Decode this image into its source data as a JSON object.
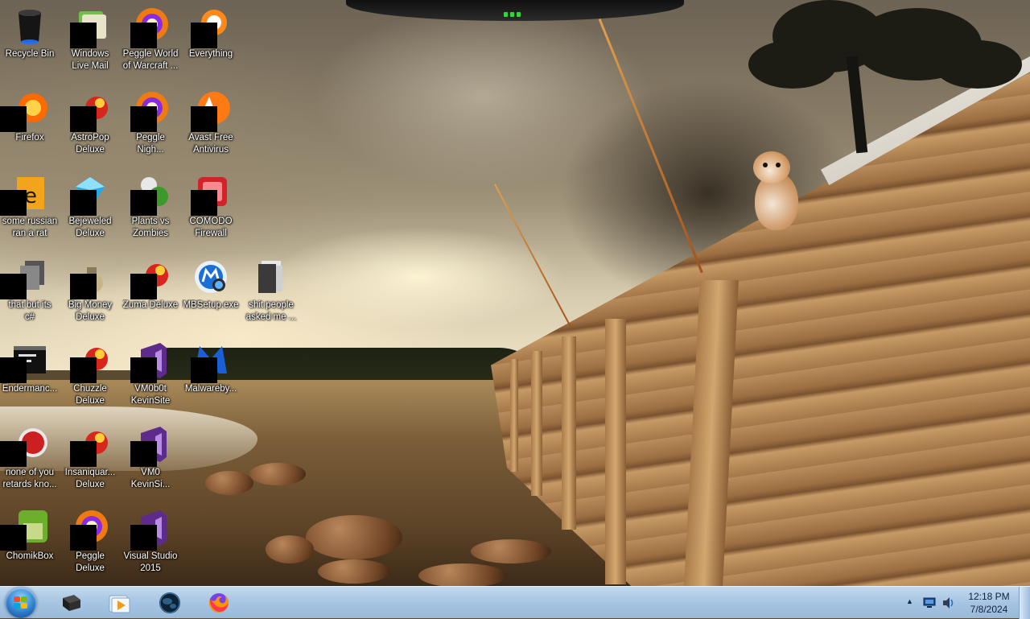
{
  "desktop": {
    "icons": [
      {
        "label": "Recycle Bin",
        "icon": "recycle-bin-icon",
        "col": 0,
        "row": 0,
        "censored": false
      },
      {
        "label": "Windows\nLive Mail",
        "icon": "mail-icon",
        "col": 1,
        "row": 0,
        "censored": true
      },
      {
        "label": "Peggle World\nof Warcraft ...",
        "icon": "peggle-icon",
        "col": 2,
        "row": 0,
        "censored": true
      },
      {
        "label": "Everything",
        "icon": "search-icon",
        "col": 3,
        "row": 0,
        "censored": true
      },
      {
        "label": "Firefox",
        "icon": "firefox-icon",
        "col": 0,
        "row": 1,
        "censored": true
      },
      {
        "label": "AstroPop\nDeluxe",
        "icon": "game-icon",
        "col": 1,
        "row": 1,
        "censored": true
      },
      {
        "label": "Peggle\nNigh...",
        "icon": "peggle-icon",
        "col": 2,
        "row": 1,
        "censored": true
      },
      {
        "label": "Avast Free\nAntivirus",
        "icon": "antivirus-icon",
        "col": 3,
        "row": 1,
        "censored": true
      },
      {
        "label": "some russian\nran a rat",
        "icon": "archive-icon",
        "col": 0,
        "row": 2,
        "censored": true
      },
      {
        "label": "Bejeweled\nDeluxe",
        "icon": "gem-icon",
        "col": 1,
        "row": 2,
        "censored": true
      },
      {
        "label": "Plants vs\nZombies",
        "icon": "plant-icon",
        "col": 2,
        "row": 2,
        "censored": true
      },
      {
        "label": "COMODO\nFirewall",
        "icon": "firewall-icon",
        "col": 3,
        "row": 2,
        "censored": true
      },
      {
        "label": "that but its\nc#",
        "icon": "file-icon",
        "col": 0,
        "row": 3,
        "censored": true
      },
      {
        "label": "Big Money\nDeluxe",
        "icon": "money-bag-icon",
        "col": 1,
        "row": 3,
        "censored": true
      },
      {
        "label": "Zuma Deluxe",
        "icon": "game-icon",
        "col": 2,
        "row": 3,
        "censored": true
      },
      {
        "label": "MBSetup.exe",
        "icon": "malwarebytes-setup-icon",
        "col": 3,
        "row": 3,
        "censored": false
      },
      {
        "label": "shit people\nasked me ...",
        "icon": "folder-icon",
        "col": 4,
        "row": 3,
        "censored": false
      },
      {
        "label": "Endermanc...",
        "icon": "terminal-icon",
        "col": 0,
        "row": 4,
        "censored": true
      },
      {
        "label": "Chuzzle\nDeluxe",
        "icon": "game-icon",
        "col": 1,
        "row": 4,
        "censored": true
      },
      {
        "label": "VM0b0t\nKevinSite",
        "icon": "visual-studio-icon",
        "col": 2,
        "row": 4,
        "censored": true
      },
      {
        "label": "Malwareby...",
        "icon": "malwarebytes-icon",
        "col": 3,
        "row": 4,
        "censored": true
      },
      {
        "label": "none of you\nretards kno...",
        "icon": "app-icon",
        "col": 0,
        "row": 5,
        "censored": true
      },
      {
        "label": "Insaniquar...\nDeluxe",
        "icon": "game-icon",
        "col": 1,
        "row": 5,
        "censored": true
      },
      {
        "label": "VM0\nKevinSi...",
        "icon": "visual-studio-icon",
        "col": 2,
        "row": 5,
        "censored": true
      },
      {
        "label": "ChomikBox",
        "icon": "chomikbox-icon",
        "col": 0,
        "row": 6,
        "censored": true
      },
      {
        "label": "Peggle\nDeluxe",
        "icon": "peggle-icon",
        "col": 1,
        "row": 6,
        "censored": true
      },
      {
        "label": "Visual Studio\n2015",
        "icon": "visual-studio-icon",
        "col": 2,
        "row": 6,
        "censored": true
      }
    ]
  },
  "taskbar": {
    "start_button": "windows-start-icon",
    "pinned": [
      {
        "icon": "command-window-icon"
      },
      {
        "icon": "media-player-icon"
      },
      {
        "icon": "globe-icon"
      },
      {
        "icon": "firefox-icon"
      }
    ],
    "tray": {
      "show_hidden_arrow": "▲",
      "network_icon": "network-icon",
      "volume_icon": "volume-icon"
    },
    "clock": {
      "time": "12:18 PM",
      "date": "7/8/2024"
    }
  },
  "colors": {
    "taskbar": "#a9c6e3",
    "label_text": "#ffffff",
    "accent_led": "#39d23a"
  }
}
